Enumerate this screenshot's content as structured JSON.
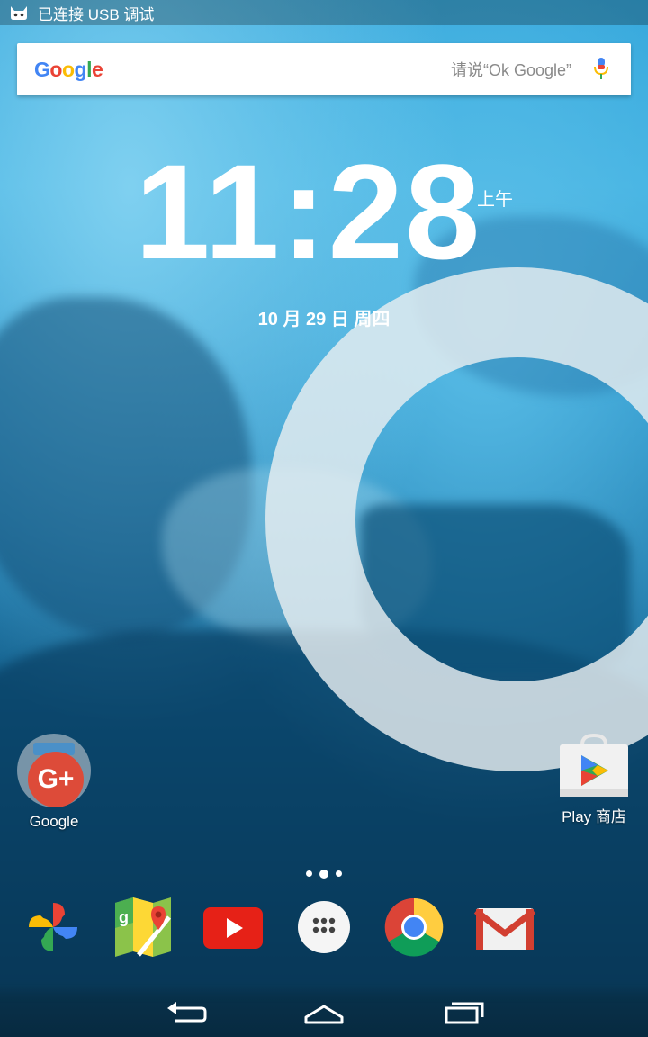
{
  "status_bar": {
    "text": "已连接 USB 调试",
    "icon": "android-debug-icon"
  },
  "search": {
    "logo_text": "Google",
    "placeholder": "请说“Ok Google”",
    "mic_icon": "mic-icon"
  },
  "clock": {
    "time": "11:28",
    "ampm": "上午",
    "date": "10 月 29 日 周四"
  },
  "desktop_apps": [
    {
      "label": "Google",
      "icon": "google-plus-folder-icon"
    },
    {
      "label": "Play 商店",
      "icon": "play-store-icon"
    }
  ],
  "dock": [
    {
      "name": "photos",
      "icon": "google-photos-icon"
    },
    {
      "name": "maps",
      "icon": "google-maps-icon"
    },
    {
      "name": "youtube",
      "icon": "youtube-icon"
    },
    {
      "name": "app-drawer",
      "icon": "app-drawer-icon"
    },
    {
      "name": "chrome",
      "icon": "chrome-icon"
    },
    {
      "name": "gmail",
      "icon": "gmail-icon"
    }
  ],
  "nav": [
    "back-icon",
    "home-icon",
    "recents-icon"
  ],
  "colors": {
    "google_blue": "#4285F4",
    "google_red": "#EA4335",
    "google_yellow": "#FBBC05",
    "google_green": "#34A853"
  }
}
